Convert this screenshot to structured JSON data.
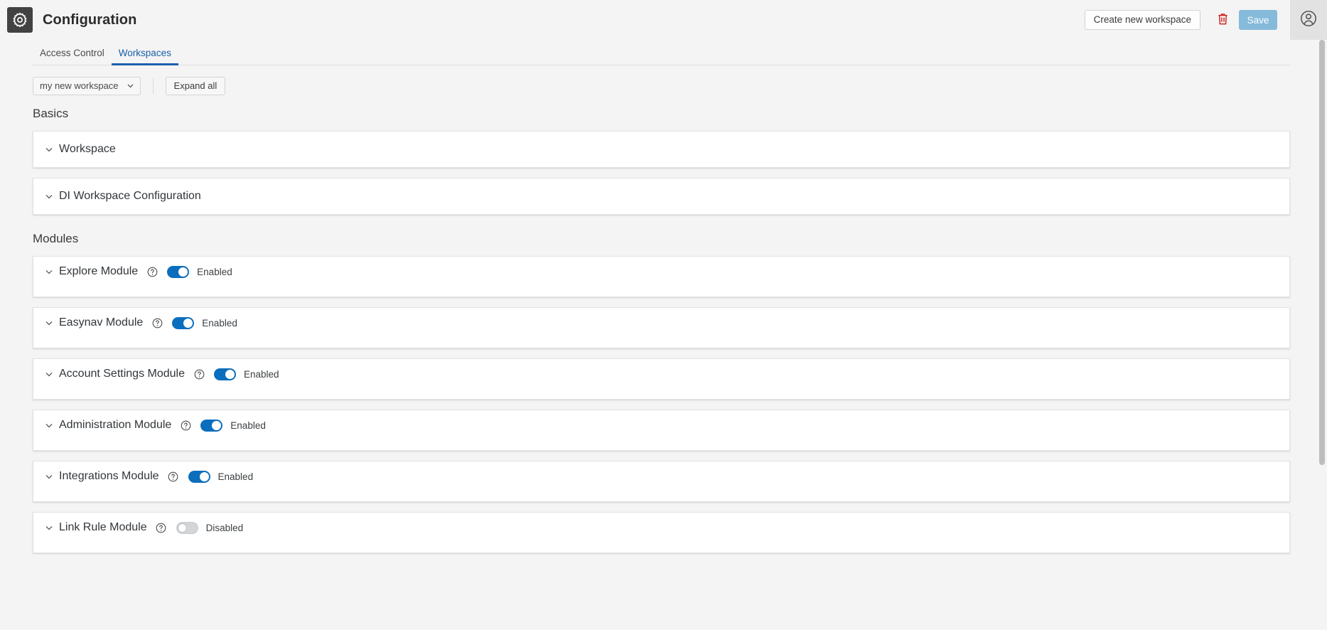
{
  "header": {
    "app_icon": "gear-icon",
    "title": "Configuration",
    "create_workspace_label": "Create new workspace",
    "delete_icon": "trash-icon",
    "save_label": "Save",
    "avatar_icon": "user-avatar-icon"
  },
  "tabs": [
    {
      "label": "Access Control",
      "active": false
    },
    {
      "label": "Workspaces",
      "active": true
    }
  ],
  "toolbar": {
    "workspace_select_value": "my new workspace",
    "workspace_select_icon": "chevron-down-icon",
    "expand_all_label": "Expand all"
  },
  "sections": [
    {
      "title": "Basics",
      "cards": [
        {
          "title": "Workspace",
          "collapse_icon": "chevron-down-icon",
          "has_toggle": false
        },
        {
          "title": "DI Workspace Configuration",
          "collapse_icon": "chevron-down-icon",
          "has_toggle": false
        }
      ]
    },
    {
      "title": "Modules",
      "cards": [
        {
          "title": "Explore Module",
          "collapse_icon": "chevron-down-icon",
          "help_icon": "help-circle-icon",
          "has_toggle": true,
          "enabled": true,
          "toggle_label": "Enabled"
        },
        {
          "title": "Easynav Module",
          "collapse_icon": "chevron-down-icon",
          "help_icon": "help-circle-icon",
          "has_toggle": true,
          "enabled": true,
          "toggle_label": "Enabled"
        },
        {
          "title": "Account Settings Module",
          "collapse_icon": "chevron-down-icon",
          "help_icon": "help-circle-icon",
          "has_toggle": true,
          "enabled": true,
          "toggle_label": "Enabled"
        },
        {
          "title": "Administration Module",
          "collapse_icon": "chevron-down-icon",
          "help_icon": "help-circle-icon",
          "has_toggle": true,
          "enabled": true,
          "toggle_label": "Enabled"
        },
        {
          "title": "Integrations Module",
          "collapse_icon": "chevron-down-icon",
          "help_icon": "help-circle-icon",
          "has_toggle": true,
          "enabled": true,
          "toggle_label": "Enabled"
        },
        {
          "title": "Link Rule Module",
          "collapse_icon": "chevron-down-icon",
          "help_icon": "help-circle-icon",
          "has_toggle": true,
          "enabled": false,
          "toggle_label": "Disabled"
        }
      ]
    }
  ],
  "colors": {
    "accent_blue": "#1b5fad",
    "toggle_on": "#0a6ebd",
    "toggle_off": "#d3d6d8",
    "save_button": "#85bada",
    "delete_red": "#cc1919",
    "page_bg": "#f4f4f4",
    "card_bg": "#ffffff"
  },
  "scrollbar": {
    "thumb_top_pct": 0,
    "thumb_height_pct": 72
  }
}
